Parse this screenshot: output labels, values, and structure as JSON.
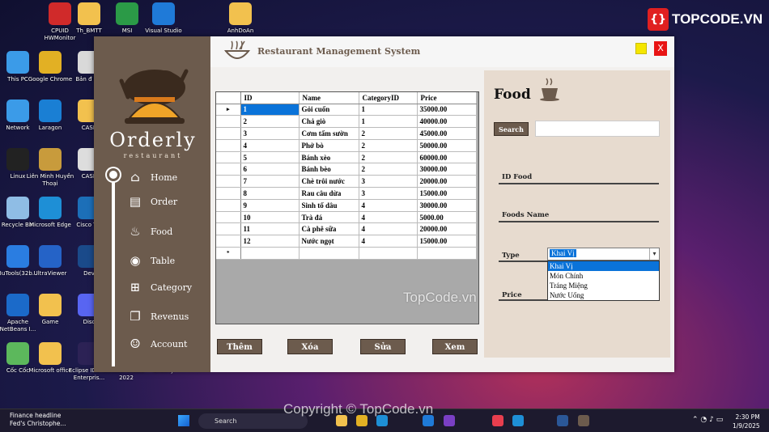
{
  "desktop": {
    "icons": [
      {
        "label": "CPUID HWMonitor",
        "color": "#d02a2a"
      },
      {
        "label": "Th_BMTT",
        "color": "#f2c14e"
      },
      {
        "label": "MSI",
        "color": "#2b9a47"
      },
      {
        "label": "Visual Studio",
        "color": "#1f7ad8"
      },
      {
        "label": "AnhDoAn",
        "color": "#f2c14e"
      },
      {
        "label": "This PC",
        "color": "#3b9be8"
      },
      {
        "label": "Google Chrome",
        "color": "#e2b024"
      },
      {
        "label": "Bản đ Lat",
        "color": "#d9d9d9"
      },
      {
        "label": "Network",
        "color": "#3b9be8"
      },
      {
        "label": "Laragon",
        "color": "#1a7fd4"
      },
      {
        "label": "CASE",
        "color": "#f2c14e"
      },
      {
        "label": "Linux",
        "color": "#222222"
      },
      {
        "label": "Liên Minh Huyền Thoại",
        "color": "#c89b3c"
      },
      {
        "label": "CASE",
        "color": "#dddddd"
      },
      {
        "label": "Recycle Bin",
        "color": "#8fbde5"
      },
      {
        "label": "Microsoft Edge",
        "color": "#1e8fd6"
      },
      {
        "label": "Cisco Tra",
        "color": "#1c6fb8"
      },
      {
        "label": "3uTools(32b...",
        "color": "#2a7de1"
      },
      {
        "label": "UltraViewer",
        "color": "#2563c7"
      },
      {
        "label": "Dev",
        "color": "#1a4a8a"
      },
      {
        "label": "Apache NetBeans I...",
        "color": "#1b6ac9"
      },
      {
        "label": "Game",
        "color": "#f2c14e"
      },
      {
        "label": "Disc",
        "color": "#5865f2"
      },
      {
        "label": "Cốc Cốc",
        "color": "#5cb85c"
      },
      {
        "label": "Microsoft office",
        "color": "#f2c14e"
      },
      {
        "label": "Eclipse IDE for Enterpris...",
        "color": "#2c2255"
      },
      {
        "label": "Visual Studio 2022",
        "color": "#7a3fc4"
      },
      {
        "label": "Orderly",
        "color": "#6c5b4d"
      }
    ]
  },
  "watermarks": {
    "brand": "TOPCODE.VN",
    "center": "TopCode.vn",
    "bottom": "Copyright © TopCode.vn"
  },
  "app": {
    "title": "Restaurant Management System",
    "close_label": "X",
    "brand": "Orderly",
    "brand_sub": "restaurant",
    "nav": [
      {
        "label": "Home",
        "icon": "home-icon"
      },
      {
        "label": "Order",
        "icon": "order-icon"
      },
      {
        "label": "Food",
        "icon": "food-icon"
      },
      {
        "label": "Table",
        "icon": "table-icon"
      },
      {
        "label": "Category",
        "icon": "category-icon"
      },
      {
        "label": "Revenus",
        "icon": "revenue-icon"
      },
      {
        "label": "Account",
        "icon": "account-icon"
      }
    ],
    "grid": {
      "columns": [
        "ID",
        "Name",
        "CategoryID",
        "Price"
      ],
      "rows": [
        [
          "1",
          "Gỏi cuốn",
          "1",
          "35000.00"
        ],
        [
          "2",
          "Chả giò",
          "1",
          "40000.00"
        ],
        [
          "3",
          "Cơm tấm sườn",
          "2",
          "45000.00"
        ],
        [
          "4",
          "Phở bò",
          "2",
          "50000.00"
        ],
        [
          "5",
          "Bánh xèo",
          "2",
          "60000.00"
        ],
        [
          "6",
          "Bánh bèo",
          "2",
          "30000.00"
        ],
        [
          "7",
          "Chè trôi nước",
          "3",
          "20000.00"
        ],
        [
          "8",
          "Rau câu dừa",
          "3",
          "15000.00"
        ],
        [
          "9",
          "Sinh tố dâu",
          "4",
          "30000.00"
        ],
        [
          "10",
          "Trà đá",
          "4",
          "5000.00"
        ],
        [
          "11",
          "Cà phê sữa",
          "4",
          "20000.00"
        ],
        [
          "12",
          "Nước ngọt",
          "4",
          "15000.00"
        ]
      ],
      "current_row_marker": "▸",
      "new_row_marker": "*"
    },
    "actions": {
      "add": "Thêm",
      "delete": "Xóa",
      "edit": "Sửa",
      "view": "Xem"
    },
    "panel": {
      "title": "Food",
      "search_label": "Search",
      "search_value": "",
      "id_label": "ID Food",
      "name_label": "Foods Name",
      "type_label": "Type",
      "price_label": "Price",
      "type_selected": "Khai Vị",
      "type_options": [
        "Khai Vị",
        "Món Chính",
        "Tráng Miệng",
        "Nước Uống"
      ]
    }
  },
  "taskbar": {
    "news_title": "Finance headline",
    "news_sub": "Fed's Christophe...",
    "search_placeholder": "Search",
    "time": "2:30 PM",
    "date": "1/9/2025"
  }
}
